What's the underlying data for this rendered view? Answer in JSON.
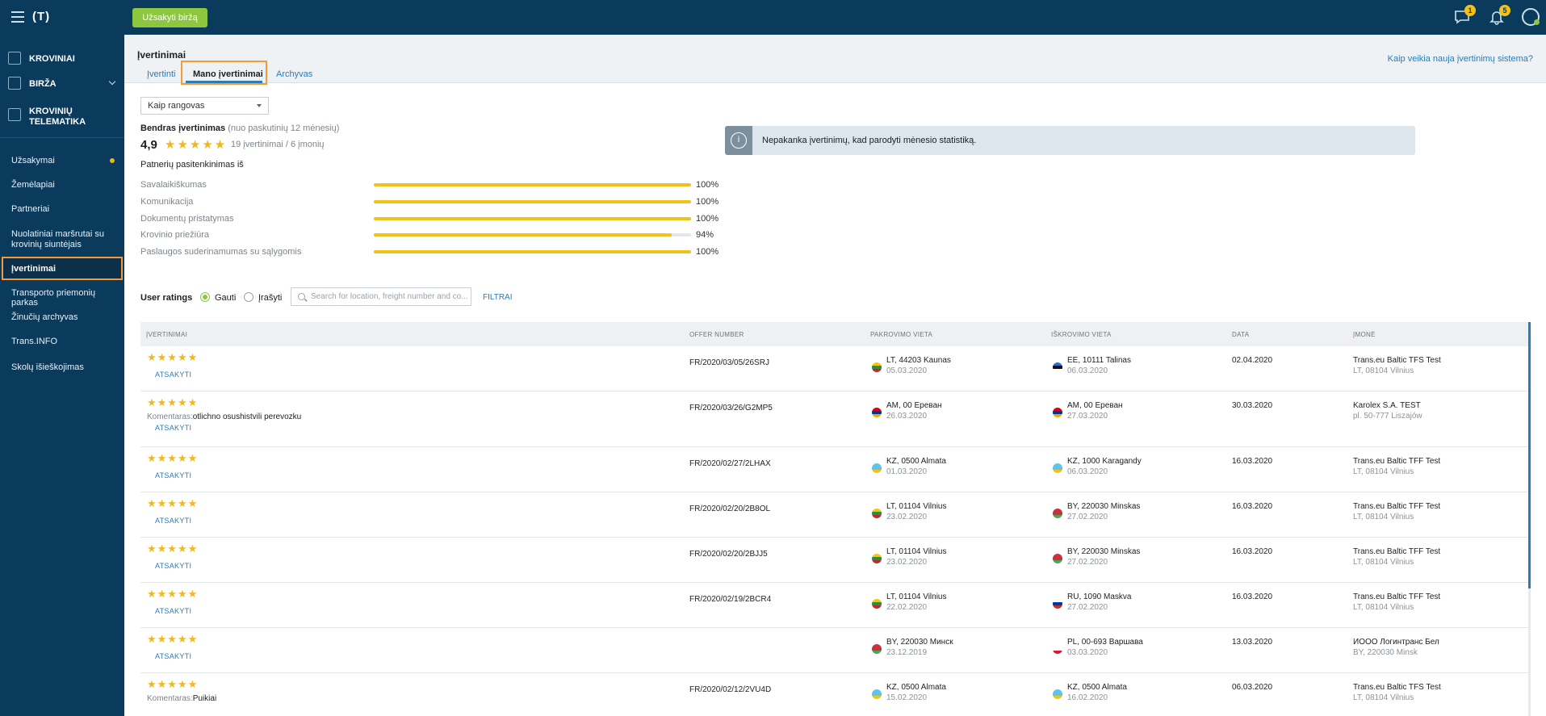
{
  "app": {
    "logo": "(T)",
    "order_button": "Užsakyti biržą",
    "messages_badge": "1",
    "notifications_badge": "5"
  },
  "sidebar": {
    "sections": [
      {
        "label": "KROVINIAI",
        "icon": "cargo-icon"
      },
      {
        "label": "BIRŽA",
        "icon": "box-icon"
      },
      {
        "label": "KROVINIŲ",
        "label2": "TELEMATIKA",
        "icon": "telematics-icon"
      }
    ],
    "items": [
      {
        "label": "Užsakymai"
      },
      {
        "label": "Žemėlapiai"
      },
      {
        "label": "Partneriai"
      },
      {
        "label": "Nuolatiniai maršrutai su",
        "label2": "krovinių siuntėjais"
      },
      {
        "label": "Įvertinimai"
      },
      {
        "label": "Transporto priemonių parkas"
      },
      {
        "label": "Žinučių archyvas"
      },
      {
        "label": "Trans.INFO"
      },
      {
        "label": "Skolų išieškojimas"
      }
    ]
  },
  "header": {
    "title": "Įvertinimai",
    "tabs": [
      "Įvertinti",
      "Mano įvertinimai",
      "Archyvas"
    ],
    "help_link": "Kaip veikia nauja įvertinimų sistema?"
  },
  "filter": {
    "role_select": "Kaip rangovas"
  },
  "overall": {
    "title": "Bendras įvertinimas",
    "period": "(nuo paskutinių 12 mėnesių)",
    "score": "4,9",
    "stars": "★★★★★",
    "count": "19 įvertinimai / 6 įmonių"
  },
  "criteria_title": "Patnerių pasitenkinimas iš",
  "criteria": [
    {
      "label": "Savalaikiškumas",
      "value": 100,
      "pct": "100%"
    },
    {
      "label": "Komunikacija",
      "value": 100,
      "pct": "100%"
    },
    {
      "label": "Dokumentų pristatymas",
      "value": 100,
      "pct": "100%"
    },
    {
      "label": "Krovinio priežiūra",
      "value": 94,
      "pct": "94%"
    },
    {
      "label": "Paslaugos suderinamumas su sąlygomis",
      "value": 100,
      "pct": "100%"
    }
  ],
  "info_message": "Nepakanka įvertinimų, kad parodyti mėnesio statistiką.",
  "user_ratings": {
    "label": "User ratings",
    "radio_received": "Gauti",
    "radio_written": "Įrašyti",
    "search_placeholder": "Search for location, freight number and co...",
    "filters_link": "FILTRAI"
  },
  "table": {
    "columns": [
      "ĮVERTINIMAI",
      "OFFER NUMBER",
      "PAKROVIMO VIETA",
      "IŠKROVIMO VIETA",
      "DATA",
      "ĮMONĖ"
    ],
    "comment_key": "Komentaras:",
    "reply_label": "ATSAKYTI",
    "rows": [
      {
        "stars": "★★★★★",
        "comment": "",
        "offer": "FR/2020/03/05/26SRJ",
        "from_flag": "lt",
        "from": "LT, 44203 Kaunas",
        "from_date": "05.03.2020",
        "to_flag": "ee",
        "to": "EE, 10111 Talinas",
        "to_date": "06.03.2020",
        "date": "02.04.2020",
        "company": "Trans.eu Baltic TFS Test",
        "company_addr": "LT, 08104 Vilnius"
      },
      {
        "stars": "★★★★★",
        "comment": "otlichno osushistvili perevozku",
        "offer": "FR/2020/03/26/G2MP5",
        "from_flag": "am",
        "from": "AM, 00 Ереван",
        "from_date": "26.03.2020",
        "to_flag": "am",
        "to": "AM, 00 Ереван",
        "to_date": "27.03.2020",
        "date": "30.03.2020",
        "company": "Karolex S.A. TEST",
        "company_addr": "pl. 50-777 Liszajów"
      },
      {
        "stars": "★★★★★",
        "comment": "",
        "offer": "FR/2020/02/27/2LHAX",
        "from_flag": "kz",
        "from": "KZ, 0500 Almata",
        "from_date": "01.03.2020",
        "to_flag": "kz",
        "to": "KZ, 1000 Karagandy",
        "to_date": "06.03.2020",
        "date": "16.03.2020",
        "company": "Trans.eu Baltic TFF Test",
        "company_addr": "LT, 08104 Vilnius"
      },
      {
        "stars": "★★★★★",
        "comment": "",
        "offer": "FR/2020/02/20/2B8OL",
        "from_flag": "lt",
        "from": "LT, 01104 Vilnius",
        "from_date": "23.02.2020",
        "to_flag": "by",
        "to": "BY, 220030 Minskas",
        "to_date": "27.02.2020",
        "date": "16.03.2020",
        "company": "Trans.eu Baltic TFF Test",
        "company_addr": "LT, 08104 Vilnius"
      },
      {
        "stars": "★★★★★",
        "comment": "",
        "offer": "FR/2020/02/20/2BJJ5",
        "from_flag": "lt",
        "from": "LT, 01104 Vilnius",
        "from_date": "23.02.2020",
        "to_flag": "by",
        "to": "BY, 220030 Minskas",
        "to_date": "27.02.2020",
        "date": "16.03.2020",
        "company": "Trans.eu Baltic TFF Test",
        "company_addr": "LT, 08104 Vilnius"
      },
      {
        "stars": "★★★★★",
        "comment": "",
        "offer": "FR/2020/02/19/2BCR4",
        "from_flag": "lt",
        "from": "LT, 01104 Vilnius",
        "from_date": "22.02.2020",
        "to_flag": "ru",
        "to": "RU, 1090 Maskva",
        "to_date": "27.02.2020",
        "date": "16.03.2020",
        "company": "Trans.eu Baltic TFF Test",
        "company_addr": "LT, 08104 Vilnius"
      },
      {
        "stars": "★★★★★",
        "comment": "",
        "offer": "",
        "from_flag": "by",
        "from": "BY, 220030 Минск",
        "from_date": "23.12.2019",
        "to_flag": "pl",
        "to": "PL, 00-693 Варшава",
        "to_date": "03.03.2020",
        "date": "13.03.2020",
        "company": "ИООО Логинтранс Бел",
        "company_addr": "BY, 220030 Minsk"
      },
      {
        "stars": "★★★★★",
        "comment": "Puikiai",
        "offer": "FR/2020/02/12/2VU4D",
        "from_flag": "kz",
        "from": "KZ, 0500 Almata",
        "from_date": "15.02.2020",
        "to_flag": "kz",
        "to": "KZ, 0500 Almata",
        "to_date": "16.02.2020",
        "date": "06.03.2020",
        "company": "Trans.eu Baltic TFS Test",
        "company_addr": "LT, 08104 Vilnius"
      }
    ]
  },
  "flag_colors": {
    "lt": [
      "#f7c600",
      "#2e8b3f",
      "#c1272d"
    ],
    "ee": [
      "#2f6fd1",
      "#111111",
      "#ffffff"
    ],
    "am": [
      "#d90012",
      "#0033a0",
      "#f2a800"
    ],
    "kz": [
      "#5ec3e8",
      "#5ec3e8",
      "#f2c21b"
    ],
    "by": [
      "#c8313e",
      "#c8313e",
      "#4aa657"
    ],
    "ru": [
      "#ffffff",
      "#0039a6",
      "#d52b1e"
    ],
    "pl": [
      "#ffffff",
      "#ffffff",
      "#dc143c"
    ]
  }
}
